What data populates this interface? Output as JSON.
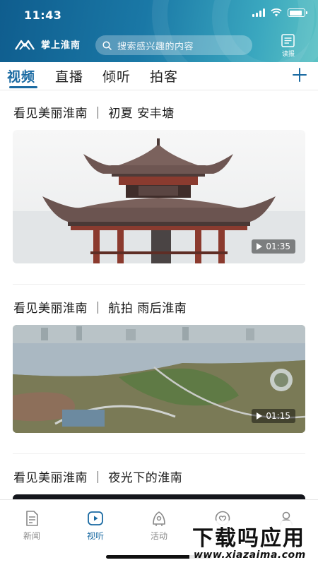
{
  "status_bar": {
    "time": "11:43"
  },
  "header": {
    "app_name": "掌上淮南",
    "search_placeholder": "搜索感兴趣的内容",
    "reader_label": "读报"
  },
  "tabs": [
    {
      "label": "视频",
      "active": true
    },
    {
      "label": "直播",
      "active": false
    },
    {
      "label": "倾听",
      "active": false
    },
    {
      "label": "拍客",
      "active": false
    }
  ],
  "feed": [
    {
      "title": "看见美丽淮南 ｜ 初夏 安丰塘",
      "duration": "01:35",
      "thumb_icon": "pavilion-image"
    },
    {
      "title": "看见美丽淮南 ｜ 航拍 雨后淮南",
      "duration": "01:15",
      "thumb_icon": "aerial-park-image"
    },
    {
      "title": "看见美丽淮南 ｜ 夜光下的淮南",
      "duration": "",
      "thumb_icon": "night-image"
    }
  ],
  "bottom_nav": [
    {
      "label": "新闻",
      "icon": "news-icon",
      "active": false
    },
    {
      "label": "视听",
      "icon": "video-play-icon",
      "active": true
    },
    {
      "label": "活动",
      "icon": "activity-icon",
      "active": false
    },
    {
      "label": "",
      "icon": "service-icon",
      "active": false
    },
    {
      "label": "",
      "icon": "profile-icon",
      "active": false
    }
  ],
  "watermark": {
    "title": "下载吗应用",
    "url": "www.xiazaima.com"
  },
  "colors": {
    "accent": "#1a6aa2",
    "header_start": "#0f5d8e",
    "header_end": "#5cc2c4"
  }
}
